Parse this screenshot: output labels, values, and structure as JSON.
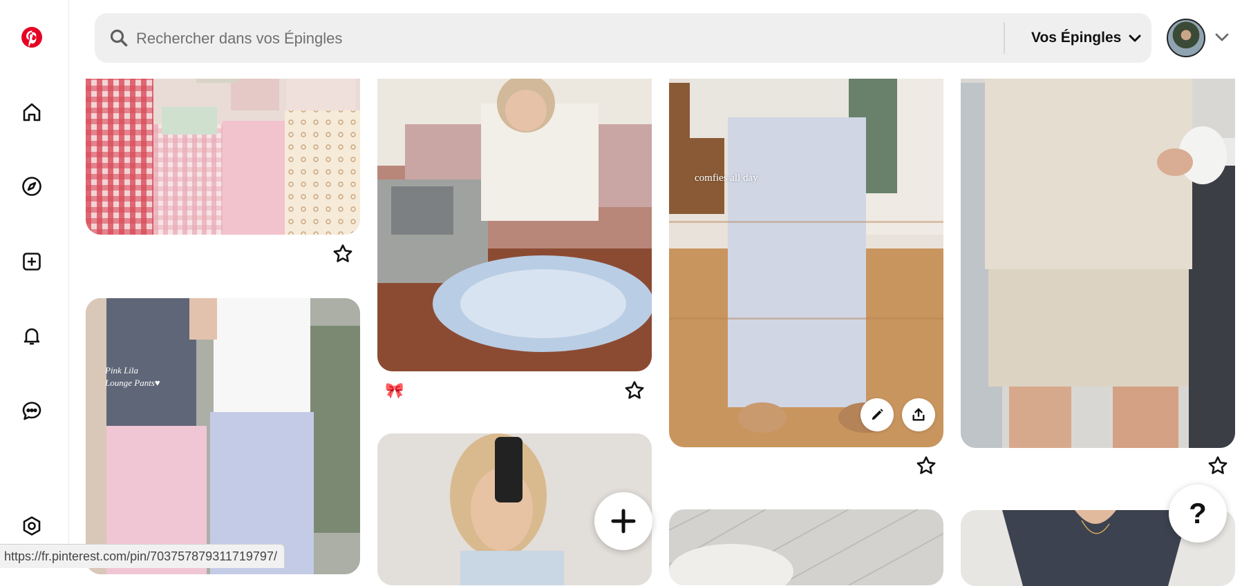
{
  "app": {
    "name": "Pinterest",
    "brand_color": "#e60023"
  },
  "nav": {
    "items": [
      {
        "name": "home",
        "icon": "home-icon"
      },
      {
        "name": "explore",
        "icon": "compass-icon"
      },
      {
        "name": "create",
        "icon": "add-box-icon"
      },
      {
        "name": "notifications",
        "icon": "bell-icon"
      },
      {
        "name": "messages",
        "icon": "chat-icon"
      },
      {
        "name": "settings",
        "icon": "settings-icon"
      }
    ]
  },
  "search": {
    "placeholder": "Rechercher dans vos Épingles",
    "value": "",
    "scope_label": "Vos Épingles"
  },
  "pins": [
    {
      "id": "fabric",
      "caption": ""
    },
    {
      "id": "sewing",
      "caption": "🎀"
    },
    {
      "id": "pajama",
      "overlay_text": "comfies all day"
    },
    {
      "id": "shorts",
      "caption": ""
    },
    {
      "id": "lounge",
      "overlay_text": "Pink Lila\nLounge Pants♥"
    },
    {
      "id": "mirror",
      "caption": ""
    },
    {
      "id": "quilt",
      "caption": ""
    },
    {
      "id": "tee",
      "caption": ""
    }
  ],
  "fabs": {
    "help_label": "?"
  },
  "status_bar": {
    "url": "https://fr.pinterest.com/pin/703757879311719797/"
  }
}
